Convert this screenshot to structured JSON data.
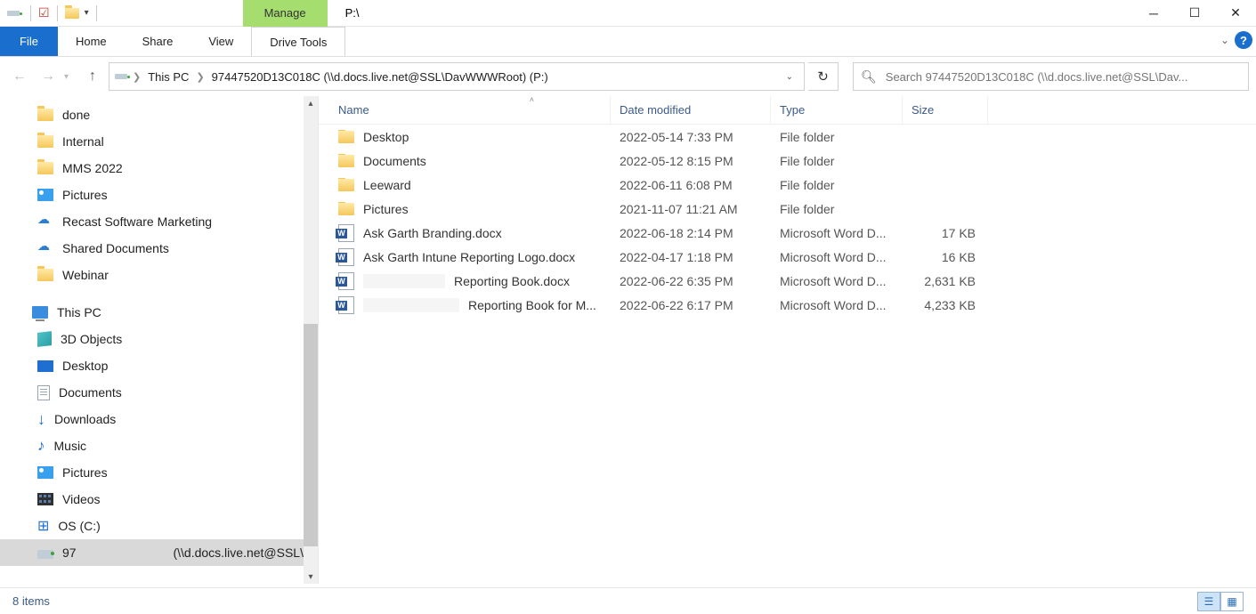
{
  "window": {
    "title": "P:\\"
  },
  "context_tab": "Manage",
  "ribbon": {
    "file": "File",
    "home": "Home",
    "share": "Share",
    "view": "View",
    "drive_tools": "Drive Tools"
  },
  "breadcrumb": {
    "root": "This PC",
    "current": "97447520D13C018C (\\\\d.docs.live.net@SSL\\DavWWWRoot) (P:)"
  },
  "search_placeholder": "Search 97447520D13C018C (\\\\d.docs.live.net@SSL\\Dav...",
  "tree": {
    "items": [
      {
        "icon": "folder",
        "label": "done",
        "indent": 2
      },
      {
        "icon": "folder",
        "label": "Internal",
        "indent": 2
      },
      {
        "icon": "folder",
        "label": "MMS 2022",
        "indent": 2
      },
      {
        "icon": "pictures",
        "label": "Pictures",
        "indent": 2
      },
      {
        "icon": "cloud",
        "label": "Recast Software Marketing",
        "indent": 2
      },
      {
        "icon": "cloud",
        "label": "Shared Documents",
        "indent": 2
      },
      {
        "icon": "folder",
        "label": "Webinar",
        "indent": 2
      }
    ],
    "this_pc": "This PC",
    "pc_items": [
      {
        "icon": "cube",
        "label": "3D Objects"
      },
      {
        "icon": "desktop",
        "label": "Desktop"
      },
      {
        "icon": "document",
        "label": "Documents"
      },
      {
        "icon": "download",
        "label": "Downloads"
      },
      {
        "icon": "music",
        "label": "Music"
      },
      {
        "icon": "pictures",
        "label": "Pictures"
      },
      {
        "icon": "video",
        "label": "Videos"
      },
      {
        "icon": "os",
        "label": "OS (C:)"
      },
      {
        "icon": "drive",
        "label": "97                            (\\\\d.docs.live.net@SSL\\",
        "selected": true
      }
    ]
  },
  "columns": {
    "name": "Name",
    "date": "Date modified",
    "type": "Type",
    "size": "Size"
  },
  "files": [
    {
      "icon": "folder",
      "name": "Desktop",
      "date": "2022-05-14 7:33 PM",
      "type": "File folder",
      "size": ""
    },
    {
      "icon": "folder",
      "name": "Documents",
      "date": "2022-05-12 8:15 PM",
      "type": "File folder",
      "size": ""
    },
    {
      "icon": "folder",
      "name": "Leeward",
      "date": "2022-06-11 6:08 PM",
      "type": "File folder",
      "size": ""
    },
    {
      "icon": "folder",
      "name": "Pictures",
      "date": "2021-11-07 11:21 AM",
      "type": "File folder",
      "size": ""
    },
    {
      "icon": "word",
      "name": "Ask Garth Branding.docx",
      "date": "2022-06-18 2:14 PM",
      "type": "Microsoft Word D...",
      "size": "17 KB"
    },
    {
      "icon": "word",
      "name": "Ask Garth Intune Reporting Logo.docx",
      "date": "2022-04-17 1:18 PM",
      "type": "Microsoft Word D...",
      "size": "16 KB"
    },
    {
      "icon": "word",
      "name": "Reporting Book.docx",
      "blur_prefix": true,
      "date": "2022-06-22 6:35 PM",
      "type": "Microsoft Word D...",
      "size": "2,631 KB"
    },
    {
      "icon": "word",
      "name": "Reporting Book for M...",
      "blur_prefix": true,
      "date": "2022-06-22 6:17 PM",
      "type": "Microsoft Word D...",
      "size": "4,233 KB"
    }
  ],
  "status": "8 items"
}
